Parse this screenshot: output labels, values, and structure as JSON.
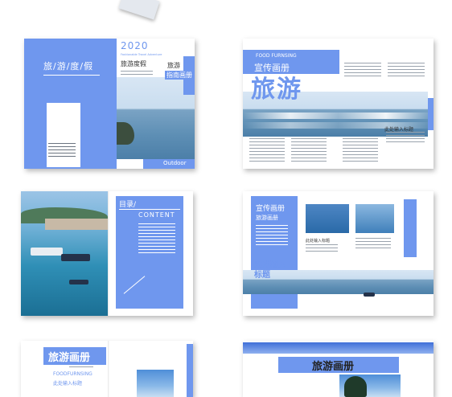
{
  "spread1": {
    "year": "2020",
    "tagline": "Fashionable Travel Adventure",
    "subtitle_left": "旅/游/度/假",
    "subtitle_right": "旅游度假",
    "vertical_1": "旅游",
    "vertical_2": "指南画册",
    "footer": "Outdoor"
  },
  "spread2": {
    "eng": "FOOD FURNSING",
    "title_small": "宣传画册",
    "title_big": "旅游",
    "caption": "此处输入标题"
  },
  "spread3": {
    "toc_cn": "目录/",
    "toc_en": "CONTENT"
  },
  "spread4": {
    "title_small": "宣传画册",
    "title_big": "旅游画册",
    "caption_1": "此处输入",
    "caption_2": "标题",
    "caption_right": "此处输入标题"
  },
  "spread5": {
    "title": "旅游画册",
    "eng": "FOODFURNSING",
    "subtitle": "此处输入标题"
  },
  "spread6": {
    "title": "旅游画册"
  },
  "colors": {
    "accent": "#6f97ee",
    "sea": "#5e8fb5"
  }
}
